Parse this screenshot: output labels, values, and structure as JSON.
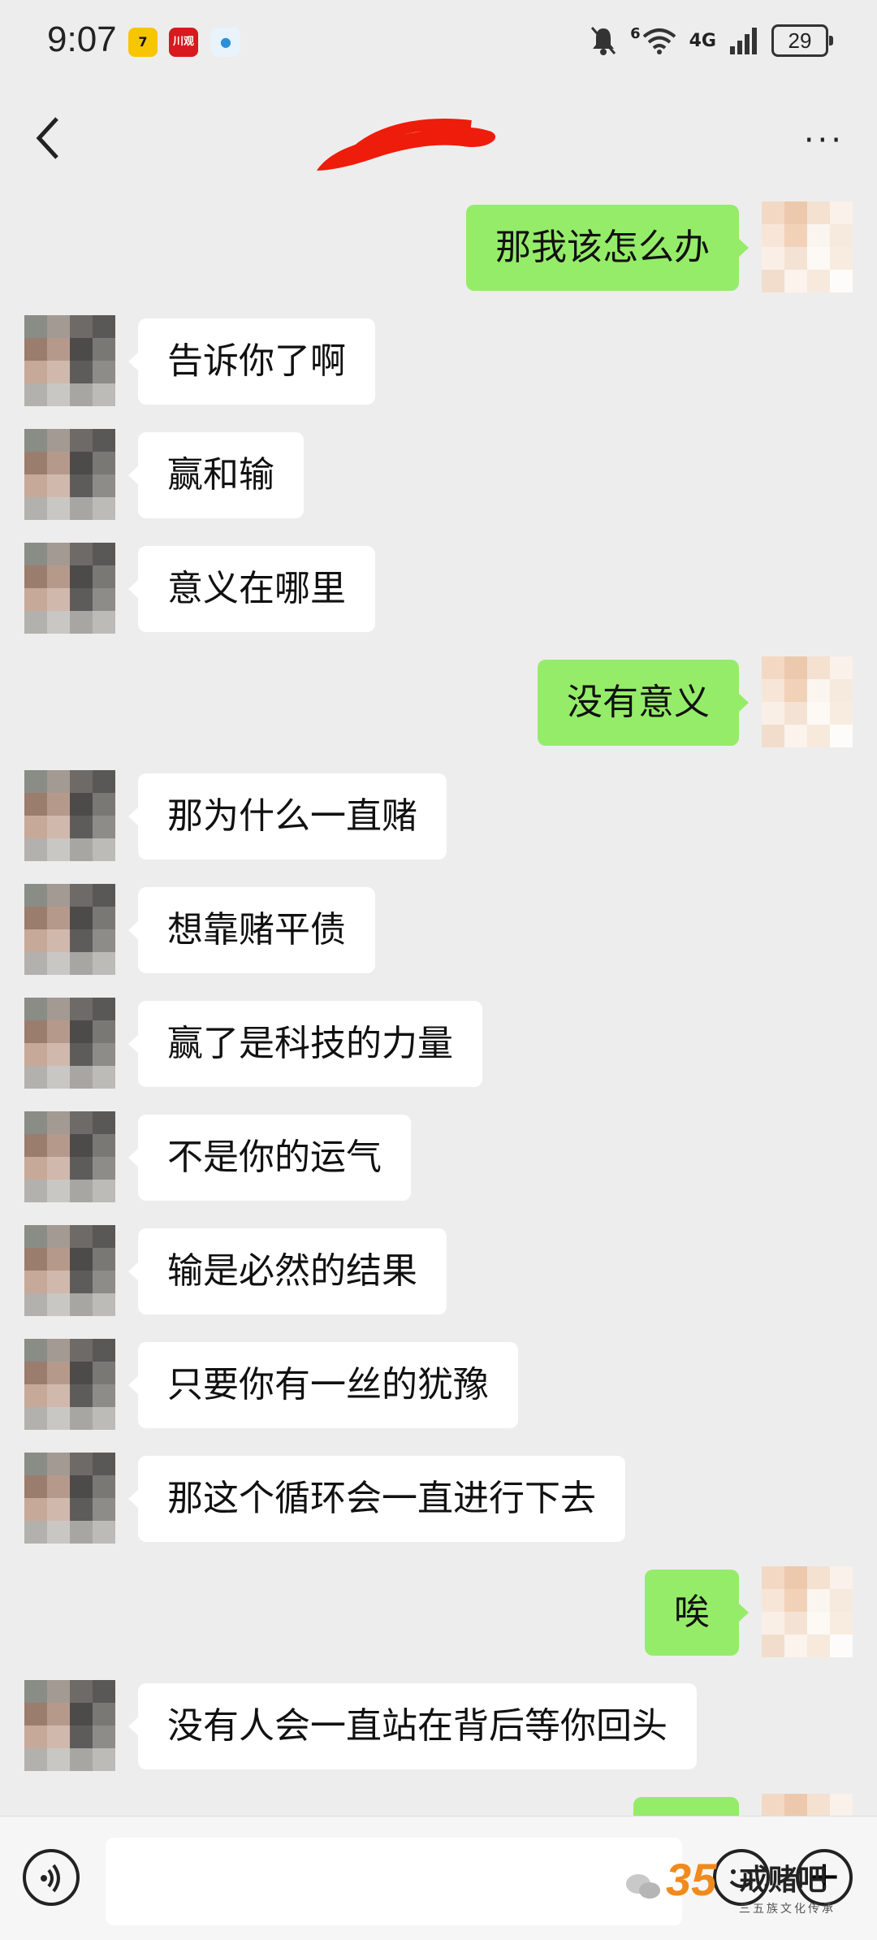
{
  "status_bar": {
    "time": "9:07",
    "app_icons": [
      "7",
      "川观",
      "●"
    ],
    "network": "4G",
    "signal_label": "6",
    "battery": "29"
  },
  "header": {
    "back_icon": "chevron-left-icon",
    "more_label": "···"
  },
  "messages": [
    {
      "side": "right",
      "text": "那我该怎么办"
    },
    {
      "side": "left",
      "text": "告诉你了啊"
    },
    {
      "side": "left",
      "text": "赢和输"
    },
    {
      "side": "left",
      "text": "意义在哪里"
    },
    {
      "side": "right",
      "text": "没有意义"
    },
    {
      "side": "left",
      "text": "那为什么一直赌"
    },
    {
      "side": "left",
      "text": "想靠赌平债"
    },
    {
      "side": "left",
      "text": "赢了是科技的力量"
    },
    {
      "side": "left",
      "text": "不是你的运气"
    },
    {
      "side": "left",
      "text": "输是必然的结果"
    },
    {
      "side": "left",
      "text": "只要你有一丝的犹豫"
    },
    {
      "side": "left",
      "text": "那这个循环会一直进行下去"
    },
    {
      "side": "right",
      "text": "唉"
    },
    {
      "side": "left",
      "text": "没有人会一直站在背后等你回头"
    },
    {
      "side": "right",
      "text": ""
    }
  ],
  "input_bar": {
    "voice_icon": "voice-icon",
    "emoji_icon": "emoji-icon",
    "plus_icon": "plus-icon",
    "plus_label": "+"
  },
  "watermark": {
    "number": "35",
    "title": "戒赌吧",
    "subtitle": "三五族文化传承"
  },
  "colors": {
    "background": "#ededed",
    "bubble_self": "#95ec69",
    "bubble_other": "#ffffff",
    "scribble": "#ee1c0a"
  }
}
